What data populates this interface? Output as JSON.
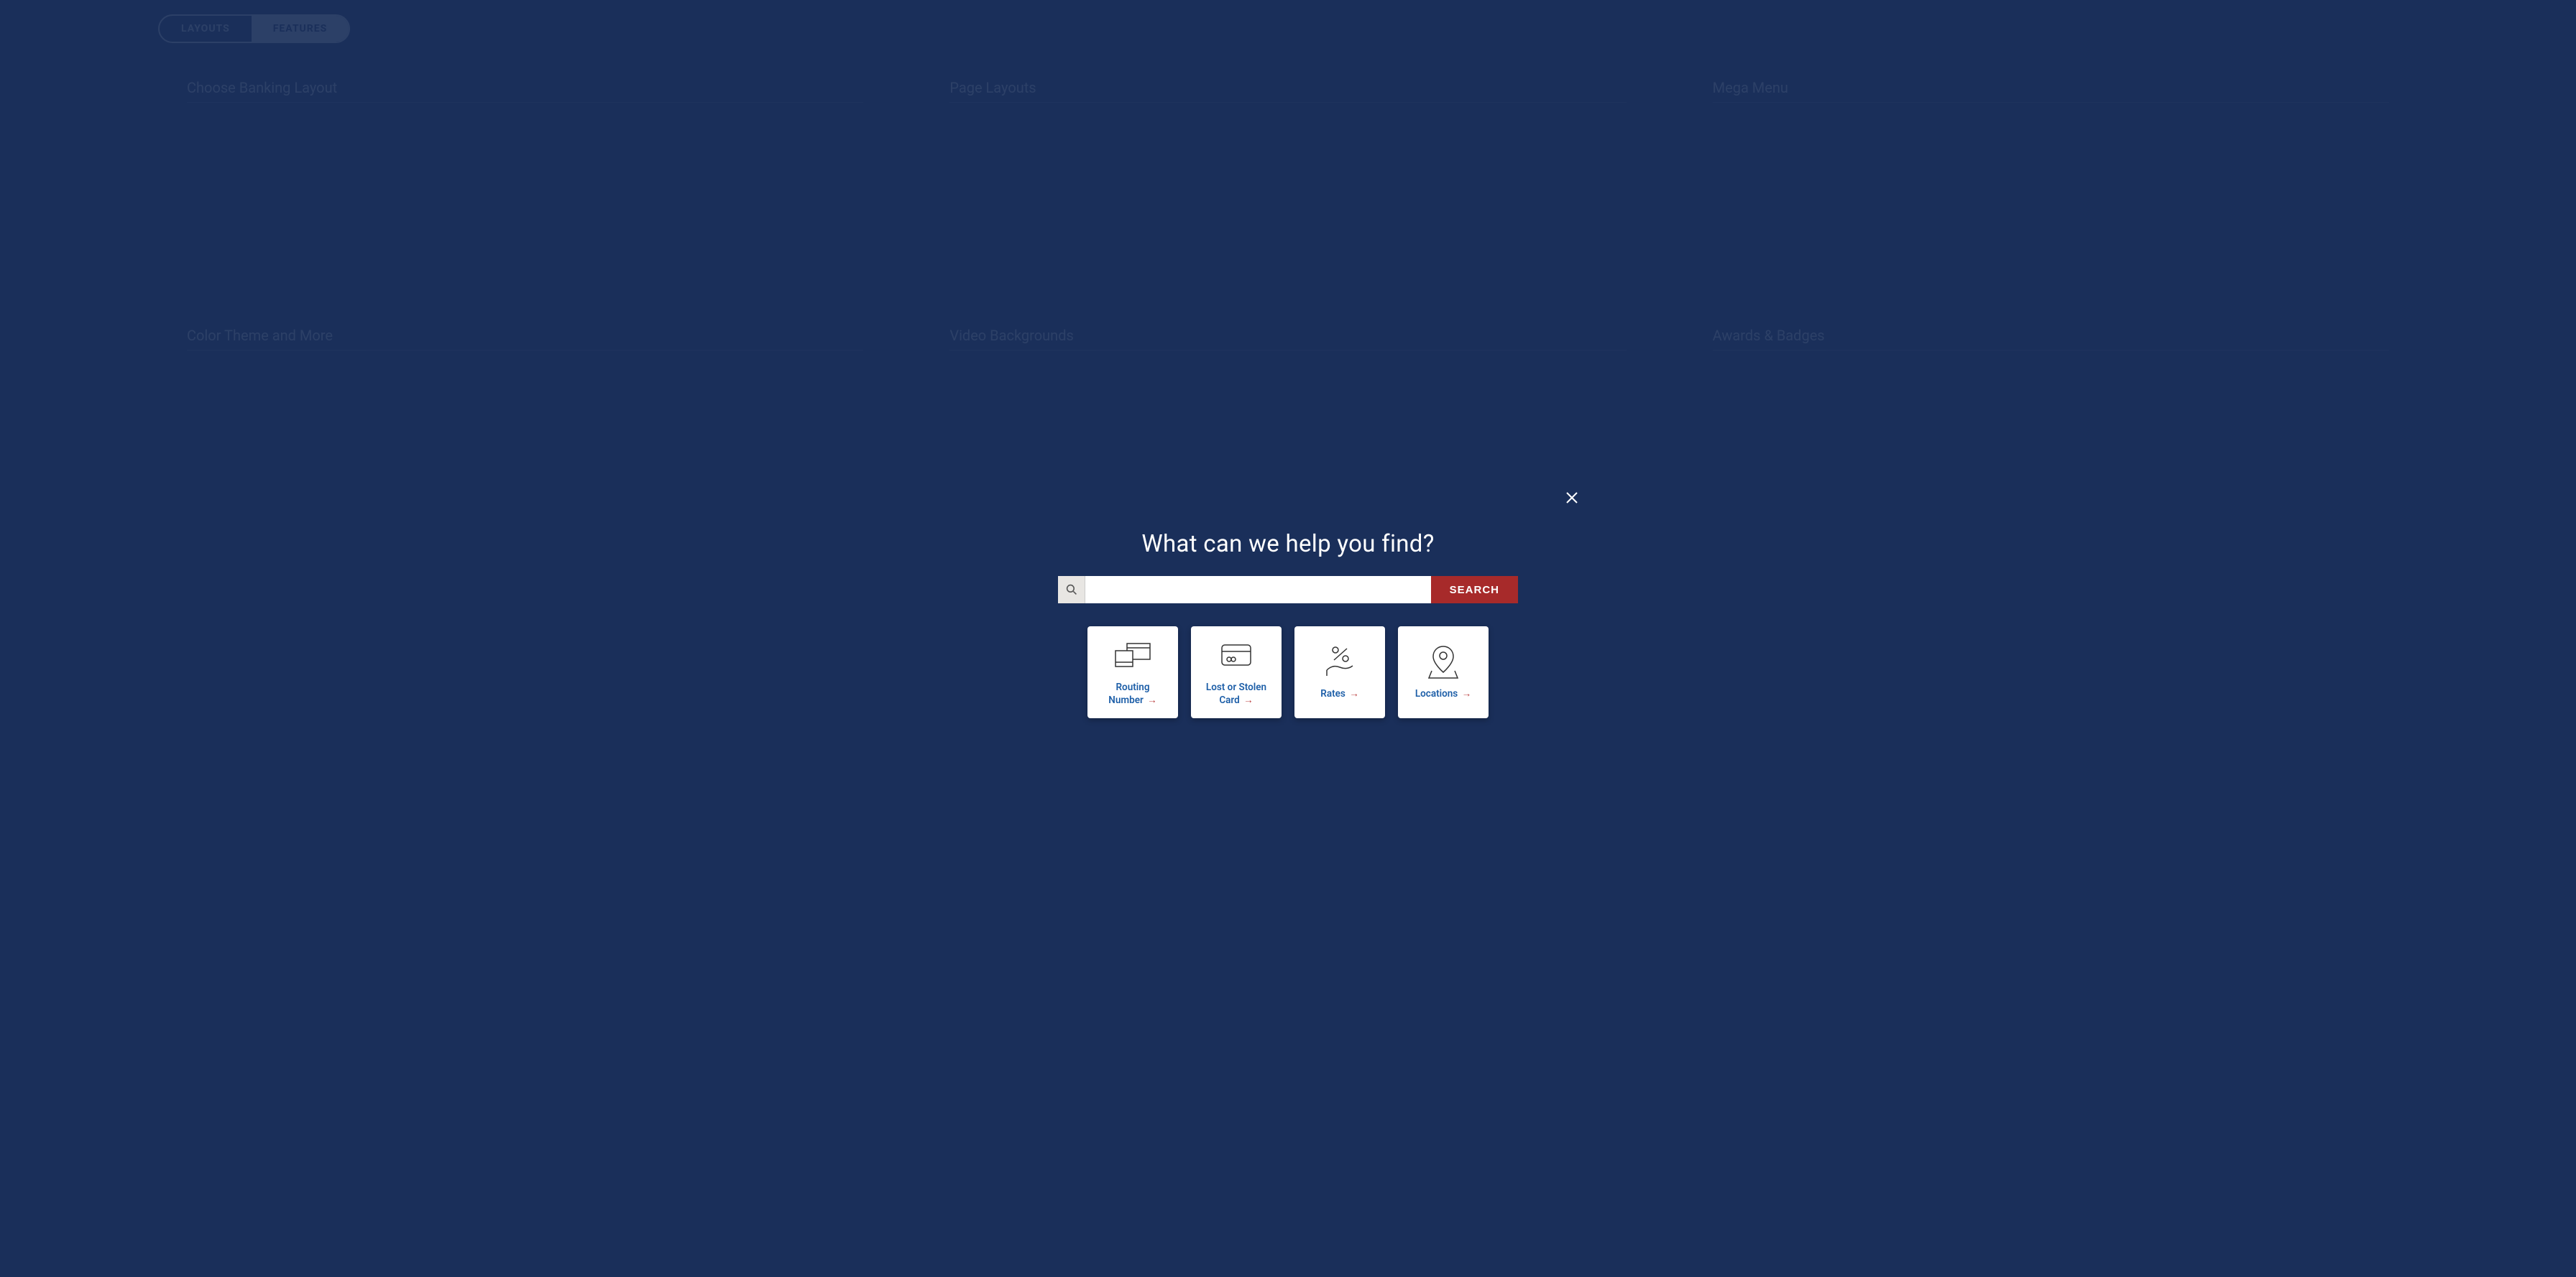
{
  "background": {
    "toggle": {
      "option1": "LAYOUTS",
      "option2": "FEATURES"
    },
    "columns": [
      {
        "heading": "Choose Banking Layout"
      },
      {
        "heading": "Page Layouts"
      },
      {
        "heading": "Mega Menu"
      },
      {
        "heading": "Color Theme and More"
      },
      {
        "heading": "Video Backgrounds"
      },
      {
        "heading": "Awards & Badges"
      }
    ]
  },
  "modal": {
    "title": "What can we help you find?",
    "search_button": "SEARCH",
    "search_placeholder": ""
  },
  "quick_links": [
    {
      "label": "Routing Number",
      "icon": "routing"
    },
    {
      "label": "Lost or Stolen Card",
      "icon": "card"
    },
    {
      "label": "Rates",
      "icon": "rates"
    },
    {
      "label": "Locations",
      "icon": "location"
    }
  ]
}
